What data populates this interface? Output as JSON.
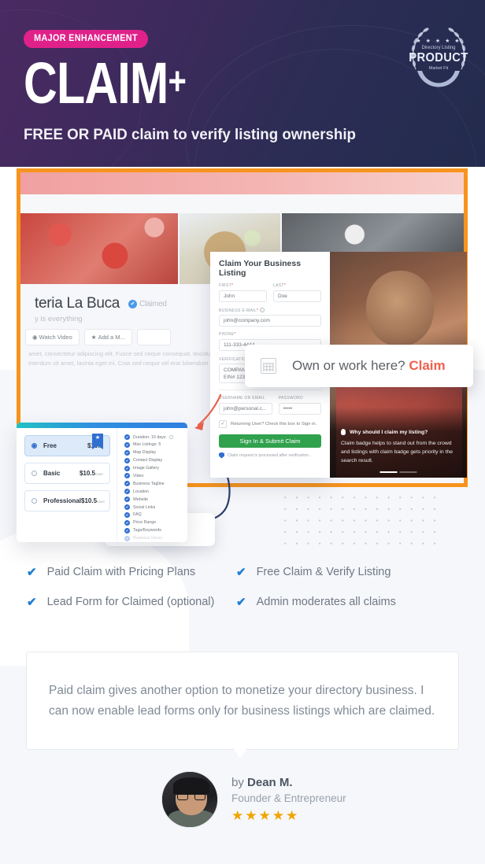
{
  "hero": {
    "badge": "MAJOR ENHANCEMENT",
    "title": "CLAIM",
    "title_plus": "+",
    "subtitle": "FREE OR PAID claim to verify listing ownership",
    "bg_color": "#3a2a5c",
    "badge_color": "#e0218a"
  },
  "award_badge": {
    "stars": "★ ★ ★ ★ ★",
    "line1": "Directory Listing",
    "line2": "PRODUCT",
    "line3": "Market Fit"
  },
  "screenshot": {
    "own_banner": {
      "icon": "calendar-icon",
      "text": "Own or work here? ",
      "link": "Claim"
    },
    "listing": {
      "title": "teria La Buca",
      "claimed_label": "Claimed",
      "tagline": "y is everything",
      "buttons": [
        "Watch Video",
        "Add a M..."
      ],
      "body_text": "amet, consectetur adipiscing elit. Fusce sed neque consequat, tincidunt tortor at, ornare et interdum sit amet, lacinia eget mi. Cras sed neque vel erat bibendum lacinia."
    },
    "claimed_popup": "Claimed",
    "form": {
      "title": "Claim Your Business Listing",
      "first_label": "FIRST",
      "first_value": "John",
      "last_label": "LAST",
      "last_value": "Doe",
      "email_label": "BUSINESS E-MAIL",
      "email_value": "john@company.com",
      "phone_label": "PHONE",
      "phone_value": "111-333-4444",
      "verify_label": "VERIFICATION DETAILS",
      "verify_value": "COMPANY LLC\nEIN# 123456",
      "username_label": "USERNAME OR EMAIL",
      "username_value": "john@personal.c...",
      "password_label": "PASSWORD",
      "password_value": "•••••",
      "checkbox_label": "Returning User? Check this box to Sign in.",
      "submit_label": "Sign In & Submit Claim",
      "note": "Claim request is processed after verification..",
      "submit_color": "#30a14c"
    },
    "photo_panel": {
      "question": "Why should I claim my listing?",
      "body": "Claim badge helps to stand out from the crowd and listings with claim badge gets priority in the search result."
    },
    "pricing": {
      "plans": [
        {
          "name": "Free",
          "price": "$10.5",
          "per": "/user",
          "selected": true,
          "ribbon": "★"
        },
        {
          "name": "Basic",
          "price": "$10.5",
          "per": "/user",
          "selected": false
        },
        {
          "name": "Professional",
          "price": "$10.5",
          "per": "/user",
          "selected": false
        }
      ],
      "features": [
        "Duration: 10 days",
        "Max Listings: 5",
        "Map Display",
        "Contact Display",
        "Image Gallery",
        "Video",
        "Business Tagline",
        "Location",
        "Website",
        "Social Links",
        "FAQ",
        "Price Range",
        "Tags/Keywords",
        "Business Hours"
      ]
    }
  },
  "features": [
    "Paid Claim with Pricing Plans",
    "Free Claim & Verify Listing",
    "Lead Form for Claimed (optional)",
    "Admin moderates all claims"
  ],
  "testimonial": {
    "quote": "Paid claim gives another option to monetize your directory business. I can now enable lead forms only for business listings which are claimed.",
    "by_prefix": "by ",
    "author": "Dean M.",
    "role": "Founder & Entrepreneur",
    "stars": "★★★★★",
    "star_color": "#f0a500"
  }
}
